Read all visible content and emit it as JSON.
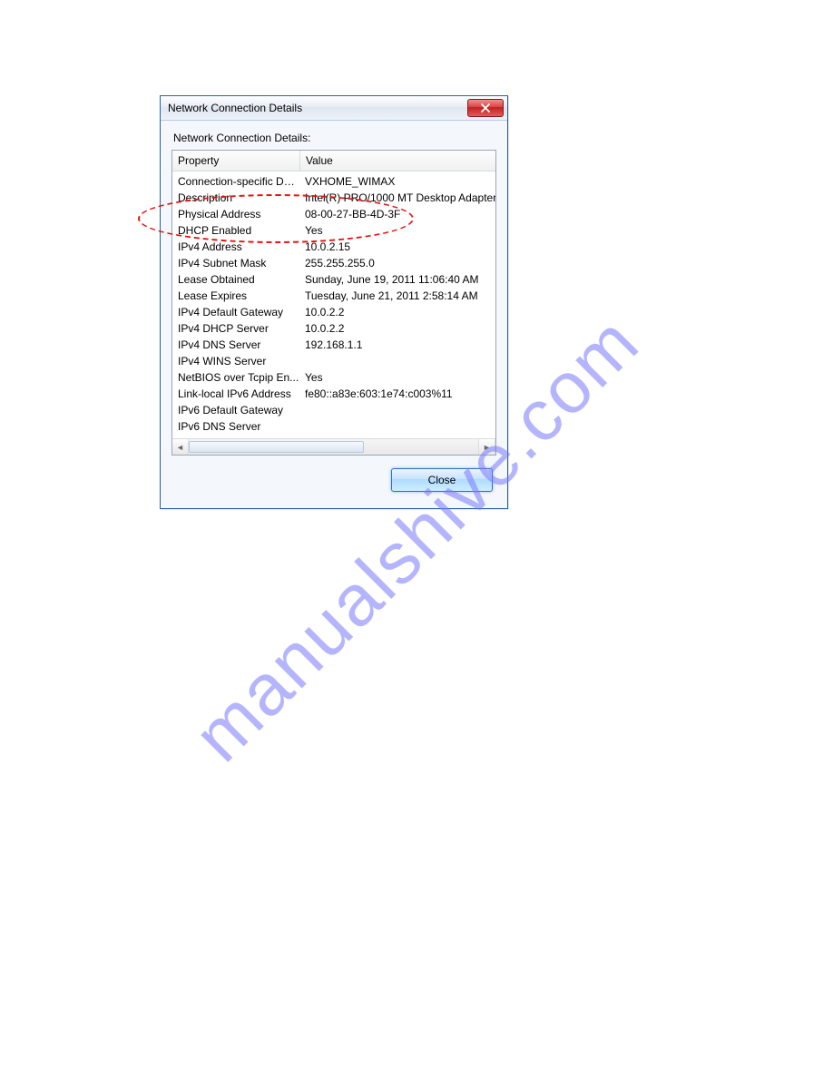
{
  "dialog": {
    "title": "Network Connection Details",
    "subtitle": "Network Connection Details:",
    "columns": {
      "property": "Property",
      "value": "Value"
    },
    "close_button_label": "Close",
    "rows": [
      {
        "property": "Connection-specific DN...",
        "value": "VXHOME_WIMAX"
      },
      {
        "property": "Description",
        "value": "Intel(R) PRO/1000 MT Desktop Adapter"
      },
      {
        "property": "Physical Address",
        "value": "08-00-27-BB-4D-3F"
      },
      {
        "property": "DHCP Enabled",
        "value": "Yes"
      },
      {
        "property": "IPv4 Address",
        "value": "10.0.2.15"
      },
      {
        "property": "IPv4 Subnet Mask",
        "value": "255.255.255.0"
      },
      {
        "property": "Lease Obtained",
        "value": "Sunday, June 19, 2011 11:06:40 AM"
      },
      {
        "property": "Lease Expires",
        "value": "Tuesday, June 21, 2011 2:58:14 AM"
      },
      {
        "property": "IPv4 Default Gateway",
        "value": "10.0.2.2"
      },
      {
        "property": "IPv4 DHCP Server",
        "value": "10.0.2.2"
      },
      {
        "property": "IPv4 DNS Server",
        "value": "192.168.1.1"
      },
      {
        "property": "IPv4 WINS Server",
        "value": ""
      },
      {
        "property": "NetBIOS over Tcpip En...",
        "value": "Yes"
      },
      {
        "property": "Link-local IPv6 Address",
        "value": "fe80::a83e:603:1e74:c003%11"
      },
      {
        "property": "IPv6 Default Gateway",
        "value": ""
      },
      {
        "property": "IPv6 DNS Server",
        "value": ""
      }
    ]
  },
  "watermark": "manualshive.com"
}
